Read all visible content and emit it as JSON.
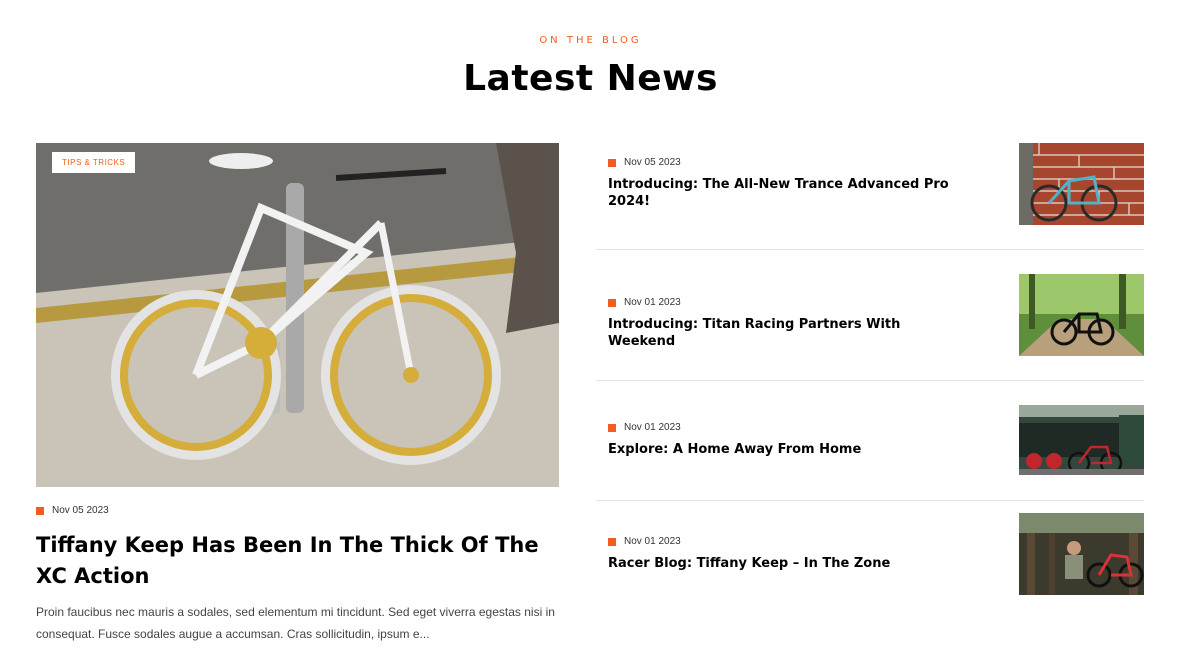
{
  "section": {
    "eyebrow": "ON THE BLOG",
    "heading": "Latest News"
  },
  "featured": {
    "tag": "TIPS & TRICKS",
    "date": "Nov 05 2023",
    "title": "Tiffany Keep Has Been In The Thick Of The XC Action",
    "excerpt": "Proin faucibus nec mauris a sodales, sed elementum mi tincidunt. Sed eget viverra egestas nisi in consequat. Fusce sodales augue a accumsan. Cras sollicitudin, ipsum e...",
    "image": "white-gold-fixie-bike-photo"
  },
  "posts": [
    {
      "date": "Nov 05 2023",
      "title": "Introducing: The All-New Trance Advanced Pro 2024!",
      "image": "bike-against-brick-wall-photo"
    },
    {
      "date": "Nov 01 2023",
      "title": "Introducing: Titan Racing Partners With Weekend",
      "image": "bike-on-forest-trail-photo"
    },
    {
      "date": "Nov 01 2023",
      "title": "Explore: A Home Away From Home",
      "image": "bike-by-steam-train-photo"
    },
    {
      "date": "Nov 01 2023",
      "title": "Racer Blog: Tiffany Keep – In The Zone",
      "image": "rider-with-bike-in-woods-photo"
    }
  ],
  "colors": {
    "accent": "#f25c1e",
    "heading": "#000000",
    "divider": "#e2e2e2"
  }
}
